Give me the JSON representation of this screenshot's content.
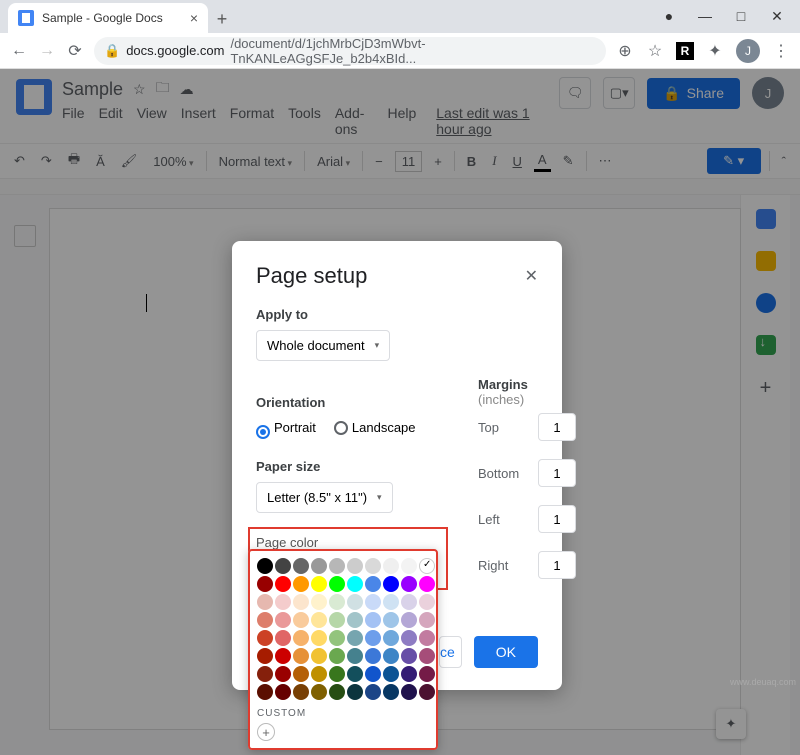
{
  "browser": {
    "tab_title": "Sample - Google Docs",
    "url_prefix": "docs.google.com",
    "url_path": "/document/d/1jchMrbCjD3mWbvt-TnKANLeAGgSFJe_b2b4xBId...",
    "avatar_initial": "J"
  },
  "docs": {
    "title": "Sample",
    "menus": [
      "File",
      "Edit",
      "View",
      "Insert",
      "Format",
      "Tools",
      "Add-ons",
      "Help"
    ],
    "last_edit": "Last edit was 1 hour ago",
    "share_label": "Share",
    "toolbar": {
      "zoom": "100%",
      "style": "Normal text",
      "font": "Arial",
      "font_size": "11"
    }
  },
  "dialog": {
    "title": "Page setup",
    "apply_to_label": "Apply to",
    "apply_to_value": "Whole document",
    "orientation_label": "Orientation",
    "orientation_portrait": "Portrait",
    "orientation_landscape": "Landscape",
    "orientation_selected": "Portrait",
    "paper_size_label": "Paper size",
    "paper_size_value": "Letter (8.5\" x 11\")",
    "page_color_label": "Page color",
    "page_color_value": "#ffffff",
    "margins_label": "Margins",
    "margins_unit": "(inches)",
    "margins": {
      "Top": "1",
      "Bottom": "1",
      "Left": "1",
      "Right": "1"
    },
    "custom_label": "CUSTOM",
    "cancel_visible_fragment": "ce",
    "ok_label": "OK"
  },
  "palette": {
    "grays": [
      "#000000",
      "#434343",
      "#666666",
      "#999999",
      "#b7b7b7",
      "#cccccc",
      "#d9d9d9",
      "#efefef",
      "#f3f3f3",
      "#ffffff"
    ],
    "brights": [
      "#980000",
      "#ff0000",
      "#ff9900",
      "#ffff00",
      "#00ff00",
      "#00ffff",
      "#4a86e8",
      "#0000ff",
      "#9900ff",
      "#ff00ff"
    ],
    "shades": [
      [
        "#e6b8af",
        "#f4cccc",
        "#fce5cd",
        "#fff2cc",
        "#d9ead3",
        "#d0e0e3",
        "#c9daf8",
        "#cfe2f3",
        "#d9d2e9",
        "#ead1dc"
      ],
      [
        "#dd7e6b",
        "#ea9999",
        "#f9cb9c",
        "#ffe599",
        "#b6d7a8",
        "#a2c4c9",
        "#a4c2f4",
        "#9fc5e8",
        "#b4a7d6",
        "#d5a6bd"
      ],
      [
        "#cc4125",
        "#e06666",
        "#f6b26b",
        "#ffd966",
        "#93c47d",
        "#76a5af",
        "#6d9eeb",
        "#6fa8dc",
        "#8e7cc3",
        "#c27ba0"
      ],
      [
        "#a61c00",
        "#cc0000",
        "#e69138",
        "#f1c232",
        "#6aa84f",
        "#45818e",
        "#3c78d8",
        "#3d85c6",
        "#674ea7",
        "#a64d79"
      ],
      [
        "#85200c",
        "#990000",
        "#b45f06",
        "#bf9000",
        "#38761d",
        "#134f5c",
        "#1155cc",
        "#0b5394",
        "#351c75",
        "#741b47"
      ],
      [
        "#5b0f00",
        "#660000",
        "#783f04",
        "#7f6000",
        "#274e13",
        "#0c343d",
        "#1c4587",
        "#073763",
        "#20124d",
        "#4c1130"
      ]
    ]
  },
  "watermark": "www.deuaq.com"
}
